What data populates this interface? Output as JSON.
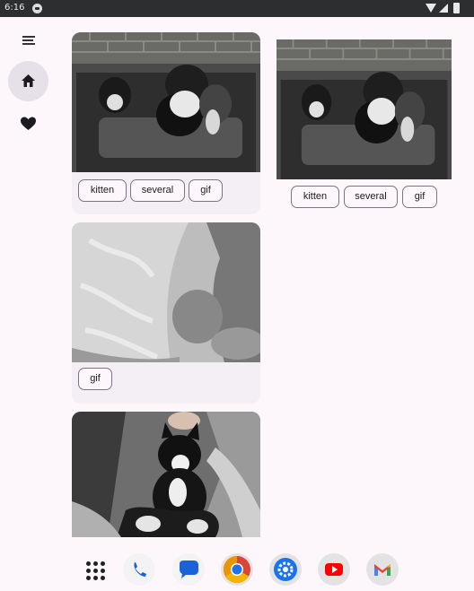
{
  "status_bar": {
    "time": "6:16",
    "icons": [
      "notification-dot-icon",
      "wifi-icon",
      "signal-icon",
      "battery-icon"
    ]
  },
  "nav_rail": {
    "items": [
      {
        "name": "menu-icon"
      },
      {
        "name": "home-icon",
        "selected": true
      },
      {
        "name": "favorite-heart-icon",
        "selected": false
      }
    ]
  },
  "gallery": {
    "cards": [
      {
        "image": "kittens-on-couch-photo",
        "tags": [
          "kitten",
          "several",
          "gif"
        ]
      },
      {
        "image": "kittens-on-couch-photo",
        "tags": [
          "kitten",
          "several",
          "gif"
        ]
      },
      {
        "image": "blurry-cat-closeup-photo",
        "tags": [
          "gif"
        ]
      },
      {
        "image": "tuxedo-cat-on-lap-photo",
        "tags": []
      }
    ]
  },
  "dock": {
    "apps": [
      "app-drawer-icon",
      "phone-icon",
      "messages-icon",
      "chrome-icon",
      "settings-icon",
      "youtube-icon",
      "gmail-icon"
    ]
  },
  "colors": {
    "background": "#fdf7fc",
    "card": "#f4eff4",
    "status_bar": "#2d2e30",
    "nav_selected": "#e6e0e8"
  }
}
